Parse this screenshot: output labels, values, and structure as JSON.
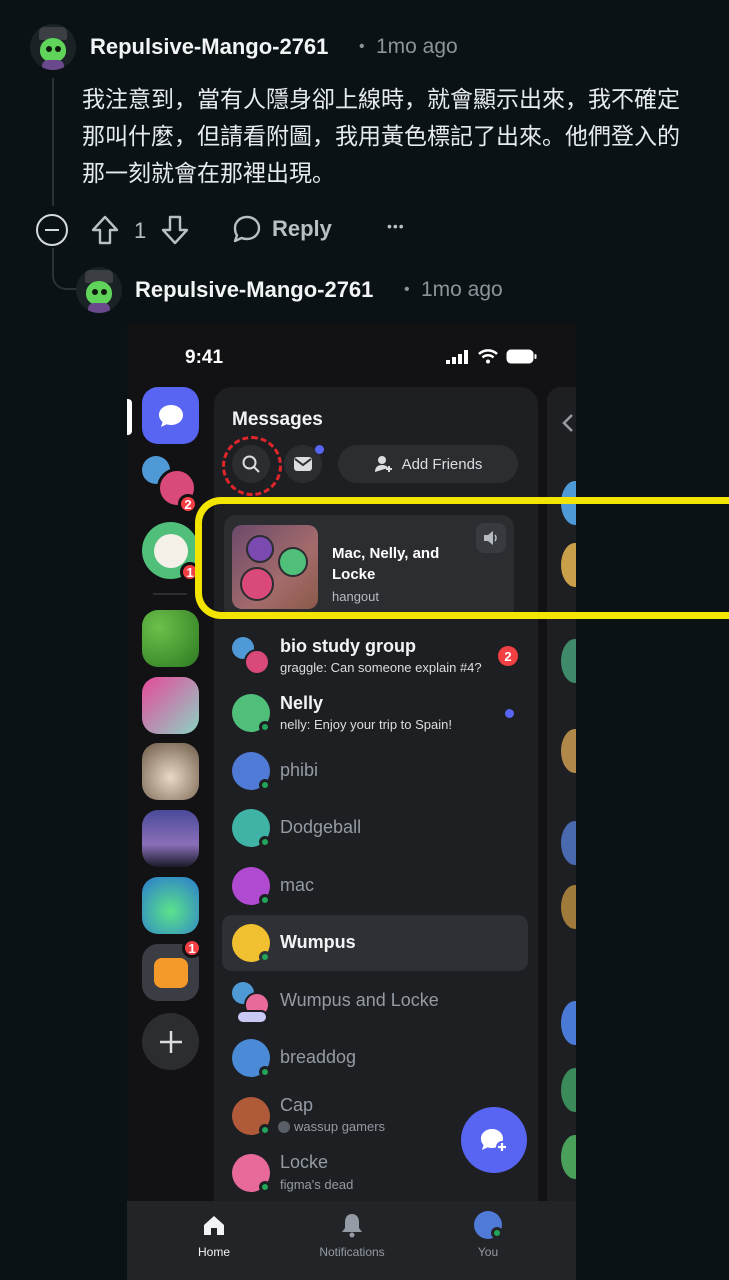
{
  "comment": {
    "username": "Repulsive-Mango-2761",
    "separator": "•",
    "time": "1mo ago",
    "text": "我注意到，當有人隱身卻上線時，就會顯示出來，我不確定那叫什麼，但請看附圖，我用黃色標記了出來。他們登入的那一刻就會在那裡出現。",
    "vote_count": "1",
    "reply_label": "Reply",
    "more_label": "•••"
  },
  "reply": {
    "username": "Repulsive-Mango-2761",
    "separator": "•",
    "time": "1mo ago"
  },
  "phone": {
    "status_time": "9:41",
    "panel_title": "Messages",
    "add_friends_label": "Add Friends",
    "rail_badges": [
      "2",
      "1",
      "1"
    ],
    "hangout": {
      "title": "Mac, Nelly, and Locke",
      "subtitle": "hangout"
    },
    "dms": [
      {
        "name": "bio study group",
        "sub": "graggle: Can someone explain #4?",
        "badge": "2"
      },
      {
        "name": "Nelly",
        "sub": "nelly: Enjoy your trip to Spain!"
      },
      {
        "name": "phibi"
      },
      {
        "name": "Dodgeball"
      },
      {
        "name": "mac"
      },
      {
        "name": "Wumpus"
      },
      {
        "name": "Wumpus and Locke"
      },
      {
        "name": "breaddog"
      },
      {
        "name": "Cap",
        "sub": "wassup gamers"
      },
      {
        "name": "Locke",
        "sub": "figma's dead"
      }
    ],
    "tabs": [
      "Home",
      "Notifications",
      "You"
    ]
  },
  "colors": {
    "highlight": "#f4e500",
    "search_ring": "#e0262b",
    "blurple": "#5865f2",
    "online": "#23a55a"
  }
}
